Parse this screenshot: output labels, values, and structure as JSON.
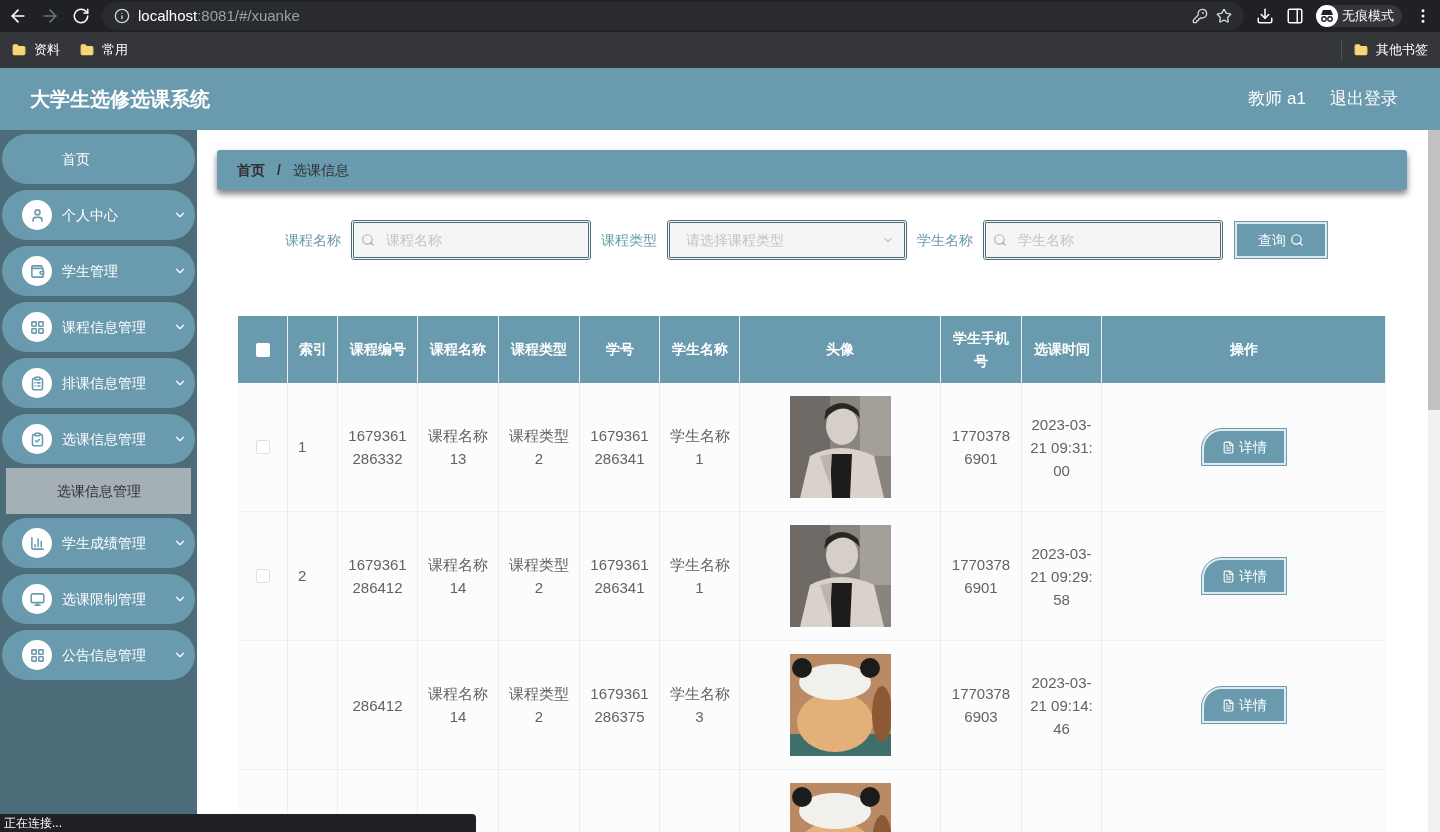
{
  "browser": {
    "back_disabled": false,
    "forward_disabled": true,
    "url_host": "localhost",
    "url_rest": ":8081/#/xuanke",
    "profile": "无痕模式",
    "bookmarks": [
      "资料",
      "常用"
    ],
    "other_bookmarks": "其他书签"
  },
  "header": {
    "title": "大学生选修选课系统",
    "user": "教师 a1",
    "logout": "退出登录"
  },
  "sidebar": {
    "items": [
      {
        "label": "首页",
        "has_icon": false
      },
      {
        "label": "个人中心",
        "has_icon": true
      },
      {
        "label": "学生管理",
        "has_icon": true
      },
      {
        "label": "课程信息管理",
        "has_icon": true
      },
      {
        "label": "排课信息管理",
        "has_icon": true
      },
      {
        "label": "选课信息管理",
        "has_icon": true,
        "children": [
          {
            "label": "选课信息管理",
            "selected": true
          }
        ]
      },
      {
        "label": "学生成绩管理",
        "has_icon": true
      },
      {
        "label": "选课限制管理",
        "has_icon": true
      },
      {
        "label": "公告信息管理",
        "has_icon": true
      }
    ]
  },
  "breadcrumb": [
    "首页",
    "选课信息"
  ],
  "breadcrumb_separator": "/",
  "filters": [
    {
      "kind": "text",
      "label": "课程名称",
      "placeholder": "课程名称"
    },
    {
      "kind": "select",
      "label": "课程类型",
      "placeholder": "请选择课程类型"
    },
    {
      "kind": "text",
      "label": "学生名称",
      "placeholder": "学生名称"
    }
  ],
  "search_button": "查询",
  "table": {
    "select_all_checked": false,
    "columns": [
      "索引",
      "课程编号",
      "课程名称",
      "课程类型",
      "学号",
      "学生名称",
      "头像",
      "学生手机号",
      "选课时间",
      "操作"
    ],
    "rows": [
      {
        "checked": false,
        "index": "1",
        "course_code": "1679361286332",
        "course_name": "课程名称13",
        "course_type": "课程类型2",
        "student_no": "1679361286341",
        "student_name": "学生名称1",
        "avatar": {
          "kind": "picture"
        },
        "phone": "17703786901",
        "time": "2023-03-21 09:31:00",
        "action": "详情"
      },
      {
        "checked": false,
        "index": "2",
        "course_code": "1679361286412",
        "course_name": "课程名称14",
        "course_type": "课程类型2",
        "student_no": "1679361286341",
        "student_name": "学生名称1",
        "avatar": {
          "kind": "picture"
        },
        "phone": "17703786901",
        "time": "2023-03-21 09:29:58",
        "action": "详情"
      },
      {
        "course_code": "286412",
        "course_name": "课程名称14",
        "course_type": "课程类型2",
        "student_no": "1679361286375",
        "student_name": "学生名称3",
        "avatar": {
          "kind": "picture"
        },
        "phone": "17703786903",
        "time": "2023-03-21 09:14:46",
        "action": "详情"
      },
      {
        "avatar": {
          "kind": "picture"
        }
      }
    ]
  },
  "status": "正在连接..."
}
